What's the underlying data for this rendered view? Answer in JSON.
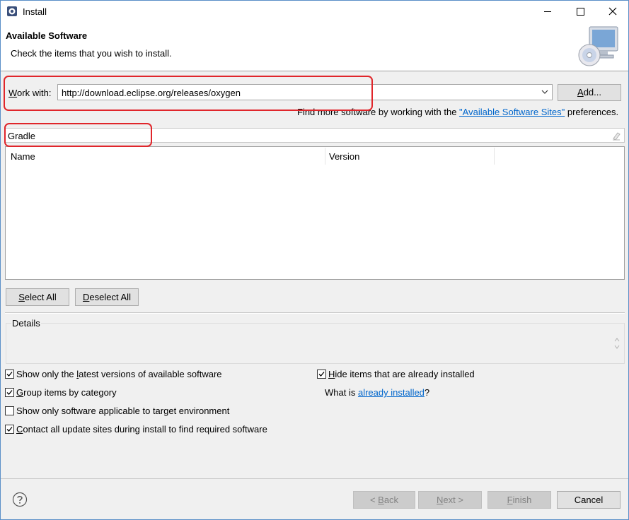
{
  "window": {
    "title": "Install",
    "icon": "eclipse-install-icon"
  },
  "header": {
    "title": "Available Software",
    "description": "Check the items that you wish to install.",
    "image": "monitor-cd-icon"
  },
  "work_with": {
    "label_prefix": "W",
    "label_rest": "ork with:",
    "value": "http://download.eclipse.org/releases/oxygen",
    "add_label_prefix": "A",
    "add_label_rest": "dd..."
  },
  "find_more": {
    "text_before": "Find more software by working with the ",
    "link": "\"Available Software Sites\"",
    "text_after": " preferences."
  },
  "filter": {
    "value": "Gradle"
  },
  "table": {
    "columns": [
      "Name",
      "Version"
    ]
  },
  "selection_buttons": {
    "select_all_prefix": "S",
    "select_all_rest": "elect All",
    "deselect_all_prefix": "D",
    "deselect_all_rest": "eselect All"
  },
  "details": {
    "label": "Details"
  },
  "options": {
    "show_latest": {
      "before": "Show only the ",
      "mn": "l",
      "after": "atest versions of available software",
      "checked": true
    },
    "group_category": {
      "before": "",
      "mn": "G",
      "after": "roup items by category",
      "checked": true
    },
    "show_applicable": {
      "before": "Show only software applicable to target environment",
      "mn": "",
      "after": "",
      "checked": false
    },
    "contact_sites": {
      "before": "",
      "mn": "C",
      "after": "ontact all update sites during install to find required software",
      "checked": true
    },
    "hide_installed": {
      "before": "",
      "mn": "H",
      "after": "ide items that are already installed",
      "checked": true
    }
  },
  "what_is": {
    "text_before": "What is ",
    "link": "already installed",
    "text_after": "?"
  },
  "footer": {
    "back_prefix": "< ",
    "back_mn": "B",
    "back_rest": "ack",
    "next_mn": "N",
    "next_rest": "ext >",
    "finish_mn": "F",
    "finish_rest": "inish",
    "cancel": "Cancel"
  },
  "annotation_color": "#e0262b"
}
